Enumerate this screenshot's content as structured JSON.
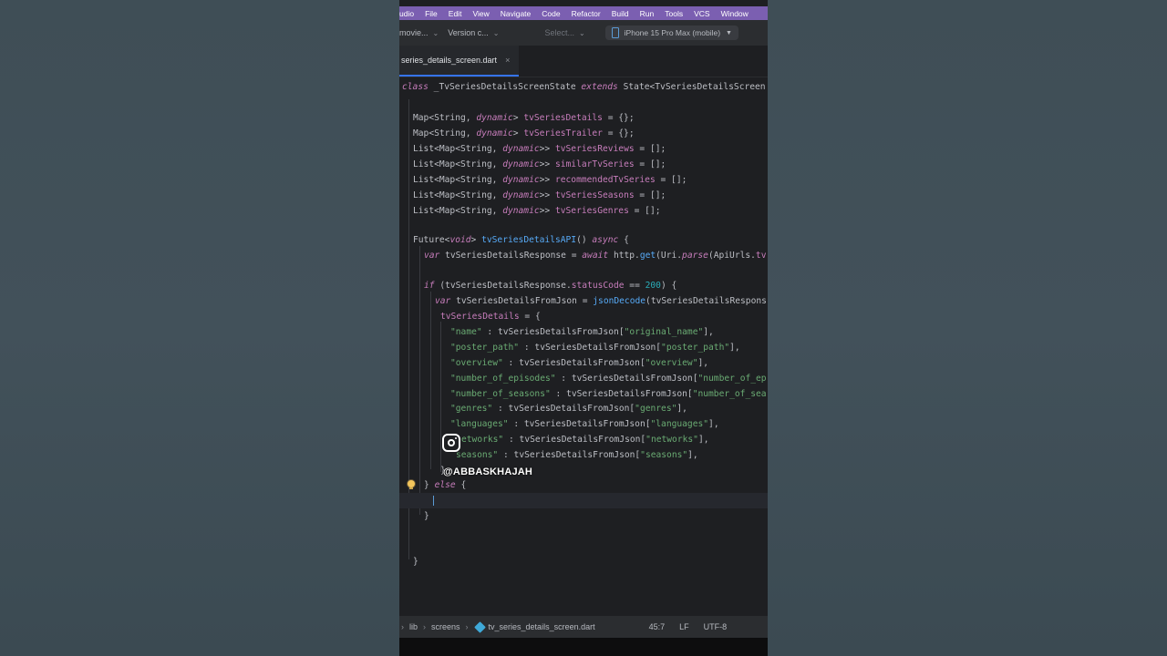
{
  "menu": [
    "udio",
    "File",
    "Edit",
    "View",
    "Navigate",
    "Code",
    "Refactor",
    "Build",
    "Run",
    "Tools",
    "VCS",
    "Window"
  ],
  "toolbar": {
    "project": "movie...",
    "version_control": "Version c...",
    "config_select": "Select...",
    "device": "iPhone 15 Pro Max (mobile)"
  },
  "tab": {
    "label": "series_details_screen.dart",
    "close": "×"
  },
  "code": {
    "class_line": "_TvSeriesDetailsScreenState",
    "extends_type": "State<TvSeriesDetailsScreen",
    "fields": [
      {
        "type": "Map<String, ",
        "dyn": "dynamic",
        "close": ">",
        "name": "tvSeriesDetails",
        "init": " = {};"
      },
      {
        "type": "Map<String, ",
        "dyn": "dynamic",
        "close": ">",
        "name": "tvSeriesTrailer",
        "init": " = {};"
      },
      {
        "type": "List<Map<String, ",
        "dyn": "dynamic",
        "close": ">>",
        "name": "tvSeriesReviews",
        "init": " = [];"
      },
      {
        "type": "List<Map<String, ",
        "dyn": "dynamic",
        "close": ">>",
        "name": "similarTvSeries",
        "init": " = [];"
      },
      {
        "type": "List<Map<String, ",
        "dyn": "dynamic",
        "close": ">>",
        "name": "recommendedTvSeries",
        "init": " = [];"
      },
      {
        "type": "List<Map<String, ",
        "dyn": "dynamic",
        "close": ">>",
        "name": "tvSeriesSeasons",
        "init": " = [];"
      },
      {
        "type": "List<Map<String, ",
        "dyn": "dynamic",
        "close": ">>",
        "name": "tvSeriesGenres",
        "init": " = [];"
      }
    ],
    "future_line": {
      "future": "Future<",
      "void": "void",
      "close": "> ",
      "fn": "tvSeriesDetailsAPI",
      "rest": "() ",
      "async": "async",
      "brace": " {"
    },
    "var_line": {
      "var": "var",
      "name": " tvSeriesDetailsResponse = ",
      "await": "await",
      "rest1": " http.",
      "get": "get",
      "rest2": "(Uri.",
      "parse": "parse",
      "rest3": "(ApiUrls.",
      "tv": "tv"
    },
    "if_line": {
      "if": "if",
      "rest1": " (tvSeriesDetailsResponse.",
      "status": "statusCode",
      "rest2": " == ",
      "num": "200",
      "rest3": ") {"
    },
    "json_line": {
      "var": "var",
      "rest1": " tvSeriesDetailsFromJson = ",
      "fn": "jsonDecode",
      "rest2": "(tvSeriesDetailsRespons"
    },
    "assign_line": {
      "field": "tvSeriesDetails",
      "rest": " = {"
    },
    "map_entries": [
      {
        "key": "\"name\"",
        "mid": " : tvSeriesDetailsFromJson[",
        "val": "\"original_name\"",
        "end": "],"
      },
      {
        "key": "\"poster_path\"",
        "mid": " : tvSeriesDetailsFromJson[",
        "val": "\"poster_path\"",
        "end": "],"
      },
      {
        "key": "\"overview\"",
        "mid": " : tvSeriesDetailsFromJson[",
        "val": "\"overview\"",
        "end": "],"
      },
      {
        "key": "\"number_of_episodes\"",
        "mid": " : tvSeriesDetailsFromJson[",
        "val": "\"number_of_ep",
        "end": ""
      },
      {
        "key": "\"number_of_seasons\"",
        "mid": " : tvSeriesDetailsFromJson[",
        "val": "\"number_of_sea",
        "end": ""
      },
      {
        "key": "\"genres\"",
        "mid": " : tvSeriesDetailsFromJson[",
        "val": "\"genres\"",
        "end": "],"
      },
      {
        "key": "\"languages\"",
        "mid": " : tvSeriesDetailsFromJson[",
        "val": "\"languages\"",
        "end": "],"
      },
      {
        "key": "etworks\"",
        "mid": " : tvSeriesDetailsFromJson[",
        "val": "\"networks\"",
        "end": "],"
      },
      {
        "key": "seasons\"",
        "mid": " : tvSeriesDetailsFromJson[",
        "val": "\"seasons\"",
        "end": "],"
      }
    ],
    "close_map": "}",
    "else_line": {
      "brace": "} ",
      "else": "else",
      "open": " {"
    },
    "close_brace": "}",
    "close_method": "}"
  },
  "watermark": "@ABBASKHAJAH",
  "status": {
    "crumbs": [
      "lib",
      "screens",
      "tv_series_details_screen.dart"
    ],
    "position": "45:7",
    "line_ending": "LF",
    "encoding": "UTF-8"
  }
}
